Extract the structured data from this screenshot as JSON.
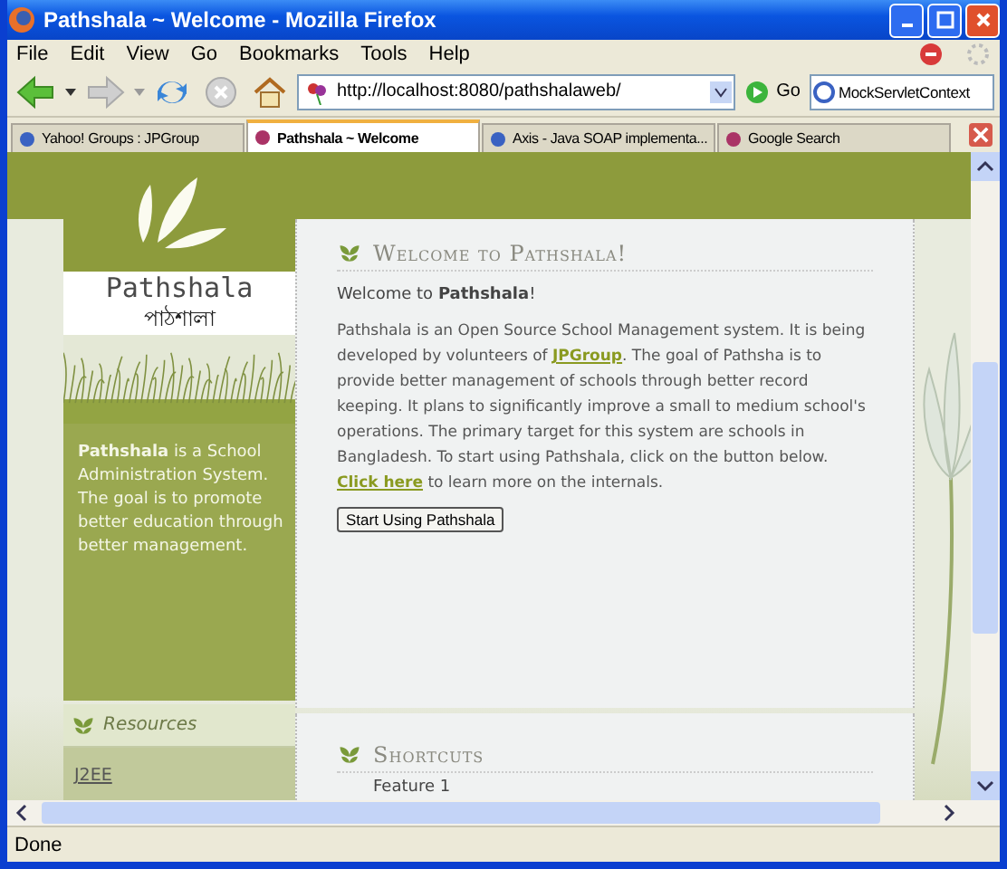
{
  "window": {
    "title": "Pathshala ~ Welcome - Mozilla Firefox"
  },
  "menu": [
    "File",
    "Edit",
    "View",
    "Go",
    "Bookmarks",
    "Tools",
    "Help"
  ],
  "toolbar": {
    "url": "http://localhost:8080/pathshalaweb/",
    "go": "Go",
    "search": "MockServletContext"
  },
  "tabs": [
    {
      "label": "Yahoo! Groups : JPGroup",
      "selected": false
    },
    {
      "label": "Pathshala ~ Welcome",
      "selected": true
    },
    {
      "label": "Axis - Java SOAP implementa...",
      "selected": false
    },
    {
      "label": "Google Search",
      "selected": false
    }
  ],
  "page": {
    "logo_title": "Pathshala",
    "logo_subtitle": "পাঠশালা",
    "blurb": "**Pathshala** is a School Administration System. The goal is to promote better education through better management.",
    "resources": {
      "heading": "Resources",
      "links": [
        "J2EE"
      ]
    },
    "welcome": {
      "heading": "Welcome to Pathshala!",
      "greeting": "Welcome to **Pathshala**!",
      "paragraph": [
        {
          "kind": "text",
          "text": "Pathshala is an Open Source School Management system. It is being developed by volunteers of "
        },
        {
          "kind": "link",
          "text": "JPGroup"
        },
        {
          "kind": "text",
          "text": ". The goal of Pathsha is to provide better management of schools through better record keeping. It plans to significantly improve a small to medium school's operations. The primary target for this system are schools in Bangladesh. To start using Pathshala, click on the button below. "
        },
        {
          "kind": "link",
          "text": "Click here"
        },
        {
          "kind": "text",
          "text": " to learn more on the internals."
        }
      ],
      "button": "Start Using Pathshala"
    },
    "shortcuts": {
      "heading": "Shortcuts",
      "items": [
        "Feature 1"
      ]
    }
  },
  "status_bar": {
    "text": "Done"
  }
}
